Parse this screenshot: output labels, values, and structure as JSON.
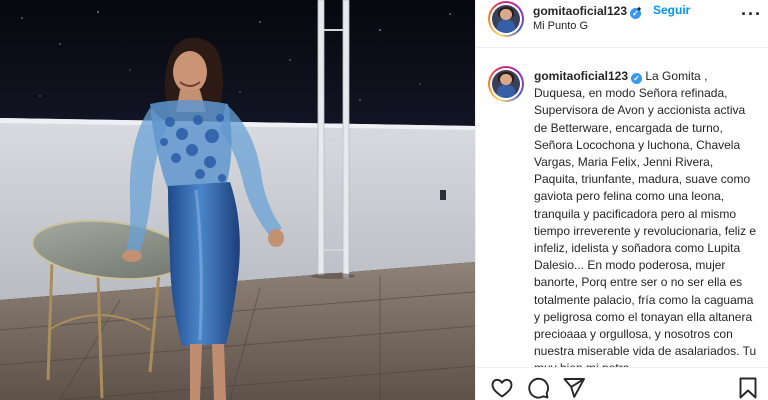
{
  "post": {
    "username": "gomitaoficial123",
    "follow_label": "Seguir",
    "separator": "•",
    "location": "Mi Punto G",
    "verified_glyph": "✓",
    "more_glyph": "···",
    "caption_text": "La Gomita , Duquesa, en modo Señora refinada, Supervisora de Avon y accionista activa de Betterware, encargada de turno, Señora Locochona y luchona, Chavela Vargas, Maria Felix, Jenni Rivera, Paquita, triunfante, madura, suave como gaviota pero felina como una leona, tranquila y pacificadora pero al mismo tiempo irreverente y revolucionaria, feliz e infeliz, idelista y soñadora como Lupita Dalesio... En modo poderosa, mujer banorte, Porq entre ser o no ser ella es totalmente palacio, fría como la caguama y peligrosa como el tonayan ella altanera precioaaa y orgullosa, y nosotros con nuestra miserable vida de asalariados. Tu muy bien mi potra"
  },
  "icons": {
    "avatar": "profile-avatar",
    "verified": "verified-badge-icon",
    "more": "more-options-icon",
    "like": "heart-icon",
    "comment": "comment-bubble-icon",
    "share": "paper-plane-icon",
    "save": "bookmark-icon"
  },
  "colors": {
    "accent": "#0095f6",
    "verified": "#3897f0",
    "text": "#262626",
    "border": "#efefef"
  }
}
